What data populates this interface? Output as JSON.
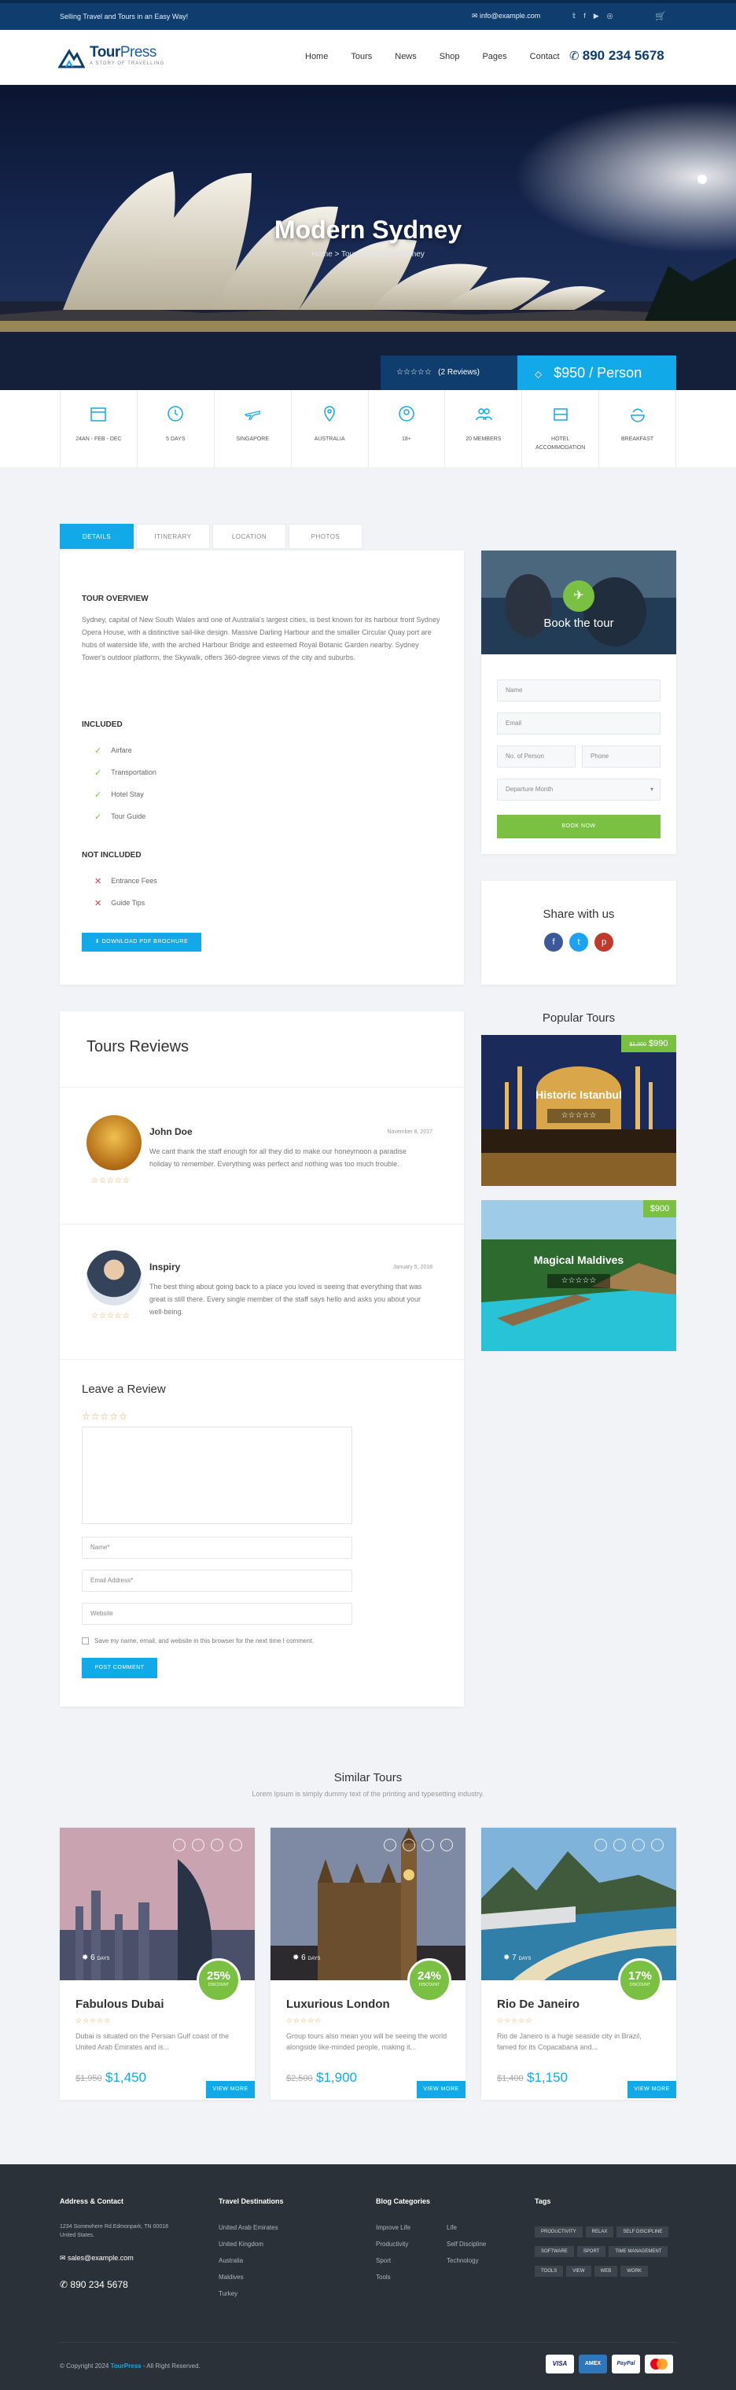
{
  "topbar": {
    "tagline": "Selling Travel and Tours in an Easy Way!",
    "email": "info@example.com"
  },
  "header": {
    "logo_name_bold": "Tour",
    "logo_name_light": "Press",
    "logo_tagline": "A STORY OF TRAVELLING",
    "nav": [
      "Home",
      "Tours",
      "News",
      "Shop",
      "Pages",
      "Contact"
    ],
    "phone": "890 234 5678"
  },
  "hero": {
    "title": "Modern Sydney",
    "breadcrumb": "Home > Tours > Modern Sydney",
    "reviews": "(2 Reviews)",
    "price": "$950 / Person"
  },
  "features": [
    "24AN - FEB - DEC",
    "5 DAYS",
    "SINGAPORE",
    "AUSTRALIA",
    "18+",
    "20 MEMBERS",
    "HOTEL ACCOMMODATION",
    "BREAKFAST"
  ],
  "tabs": [
    "DETAILS",
    "ITINERARY",
    "LOCATION",
    "PHOTOS"
  ],
  "details": {
    "overview_title": "TOUR OVERVIEW",
    "overview": "Sydney, capital of New South Wales and one of Australia's largest cities, is best known for its harbour front Sydney Opera House, with a distinctive sail-like design. Massive Darling Harbour and the smaller Circular Quay port are hubs of waterside life, with the arched Harbour Bridge and esteemed Royal Botanic Garden nearby. Sydney Tower's outdoor platform, the Skywalk, offers 360-degree views of the city and suburbs.",
    "included_title": "INCLUDED",
    "included": [
      "Airfare",
      "Transportation",
      "Hotel Stay",
      "Tour Guide"
    ],
    "not_included_title": "NOT INCLUDED",
    "not_included": [
      "Entrance Fees",
      "Guide Tips"
    ],
    "download": "DOWNLOAD PDF BROCHURE"
  },
  "booking": {
    "title": "Book the tour",
    "name": "Name",
    "email": "Email",
    "persons": "No. of Person",
    "phone": "Phone",
    "month": "Departure Month",
    "button": "BOOK NOW"
  },
  "share": {
    "title": "Share with us"
  },
  "popular": {
    "title": "Popular Tours",
    "items": [
      {
        "name": "Historic Istanbul",
        "old": "$1,000",
        "price": "$990"
      },
      {
        "name": "Magical Maldives",
        "price": "$900"
      }
    ]
  },
  "reviews": {
    "title": "Tours Reviews",
    "items": [
      {
        "name": "John Doe",
        "date": "November 8, 2017",
        "text": "We cant thank the staff enough for all they did to make our honeymoon a paradise holiday to remember. Everything was perfect and nothing was too much trouble."
      },
      {
        "name": "Inspiry",
        "date": "January 5, 2018",
        "text": "The best thing about going back to a place you loved is seeing that everything that was great is still there. Every single member of the staff says hello and asks you about your well-being."
      }
    ],
    "leave_title": "Leave a Review",
    "name_ph": "Name*",
    "email_ph": "Email Address*",
    "website_ph": "Website",
    "save_label": "Save my name, email, and website in this browser for the next time I comment.",
    "post": "POST COMMENT"
  },
  "similar": {
    "title": "Similar Tours",
    "subtitle": "Lorem Ipsum is simply dummy text of the printing and typesetting industry.",
    "items": [
      {
        "name": "Fabulous Dubai",
        "days": "6",
        "discount": "25%",
        "desc": "Dubai is situated on the Persian Gulf coast of the United Arab Emirates and is...",
        "old": "$1,950",
        "price": "$1,450"
      },
      {
        "name": "Luxurious London",
        "days": "6",
        "discount": "24%",
        "desc": "Group tours also mean you will be seeing the world alongside like-minded people, making it...",
        "old": "$2,500",
        "price": "$1,900"
      },
      {
        "name": "Rio De Janeiro",
        "days": "7",
        "discount": "17%",
        "desc": "Rio de Janeiro is a huge seaside city in Brazil, famed for its Copacabana and...",
        "old": "$1,400",
        "price": "$1,150"
      }
    ],
    "days_label": "DAYS",
    "discount_label": "DISCOUNT",
    "view_more": "VIEW MORE"
  },
  "footer": {
    "address_title": "Address & Contact",
    "address": "1234 Somewhere Rd.Edmonpark, TN 00018 United States.",
    "email": "sales@example.com",
    "phone": "890 234 5678",
    "dest_title": "Travel Destinations",
    "destinations": [
      "United Arab Emirates",
      "United Kingdom",
      "Australia",
      "Maldives",
      "Turkey"
    ],
    "blog_title": "Blog Categories",
    "blog_a": [
      "Improve Life",
      "Productivity",
      "Sport",
      "Tools"
    ],
    "blog_b": [
      "Life",
      "Self Discipline",
      "Technology"
    ],
    "tags_title": "Tags",
    "tags": [
      "PRODUCTIVITY",
      "RELAX",
      "SELF DISCIPLINE",
      "SOFTWARE",
      "SPORT",
      "TIME MANAGEMENT",
      "TOOLS",
      "VIEW",
      "WEB",
      "WORK"
    ],
    "copyright_pre": "© Copyright 2024",
    "copyright_brand": "TourPress",
    "copyright_post": "- All Right Reserved.",
    "payments": [
      "VISA",
      "AMEX",
      "PayPal",
      "MC"
    ]
  }
}
